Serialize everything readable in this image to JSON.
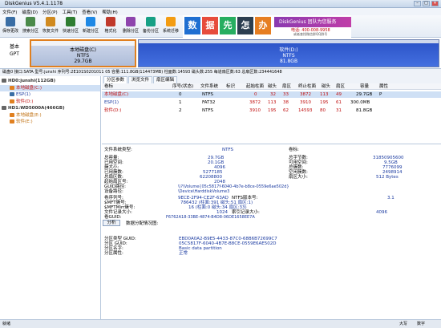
{
  "window": {
    "title": "DiskGenius V5.4.1.1178",
    "min": "–",
    "max": "□",
    "close": "✕"
  },
  "menu": [
    "文件(F)",
    "磁盘(D)",
    "分区(P)",
    "工具(T)",
    "查看(V)",
    "帮助(H)"
  ],
  "toolbar": [
    {
      "label": "保存更改",
      "icon": "save-icon",
      "color": "#3a6ea5"
    },
    {
      "label": "搜索分区",
      "icon": "search-icon",
      "color": "#4a8a4a"
    },
    {
      "label": "恢复文件",
      "icon": "recover-icon",
      "color": "#d08a20"
    },
    {
      "label": "快速分区",
      "icon": "quick-partition-icon",
      "color": "#2e7d32"
    },
    {
      "label": "新建分区",
      "icon": "new-partition-icon",
      "color": "#1e88e5"
    },
    {
      "label": "格式化",
      "icon": "format-icon",
      "color": "#c0392b"
    },
    {
      "label": "删除分区",
      "icon": "delete-icon",
      "color": "#8e44ad"
    },
    {
      "label": "备份分区",
      "icon": "backup-icon",
      "color": "#16a085"
    },
    {
      "label": "系统迁移",
      "icon": "migrate-icon",
      "color": "#f39c12"
    }
  ],
  "banner": {
    "chars": [
      "数",
      "据",
      "先",
      "怎",
      "办"
    ],
    "colors": [
      "#1f6fd1",
      "#e74c3c",
      "#27ae60",
      "#2c3e50",
      "#e67e22"
    ],
    "brand": "DiskGenius 团队为您服务",
    "phone": "电话: 400-008-9958",
    "sub": "或者查找微信群QQ群号"
  },
  "disk": {
    "label1": "基本",
    "label2": "GPT",
    "partC": {
      "name": "本地磁盘(C)",
      "fs": "NTFS",
      "size": "29.7GB"
    },
    "partD": {
      "name": "软件(D:)",
      "fs": "NTFS",
      "size": "81.8GB"
    }
  },
  "infobar": "磁盘0 接口:SATA 型号:junshi 序列号:2E101S0201011 05 容量:111.8GB(114473MB) 柱面数:14593 磁头数:255 每道扇区数:63 总扇区数:234441648",
  "tree": [
    {
      "label": "HD0:junshi(112GB)",
      "indent": 2,
      "color": "#333",
      "icon": "disk-icon"
    },
    {
      "label": "本地磁盘(C:)",
      "indent": 12,
      "color": "#c01010",
      "icon": "partition-icon",
      "selected": true
    },
    {
      "label": "ESP(1)",
      "indent": 12,
      "color": "#1a3aa0",
      "icon": "partition-icon"
    },
    {
      "label": "软件(D:)",
      "indent": 12,
      "color": "#c01010",
      "icon": "partition-icon"
    },
    {
      "label": "HD1:WD5000A(466GB)",
      "indent": 2,
      "color": "#333",
      "icon": "disk-icon"
    },
    {
      "label": "本地磁盘(E:)",
      "indent": 12,
      "color": "#c07010",
      "icon": "partition-icon"
    },
    {
      "label": "软件(E:)",
      "indent": 12,
      "color": "#c07010",
      "icon": "partition-icon"
    }
  ],
  "tabs": [
    "分区参数",
    "浏览文件",
    "扇区编辑"
  ],
  "table": {
    "headers": [
      "卷标",
      "序号(状态)",
      "文件系统",
      "标识",
      "起始柱面",
      "磁头",
      "扇区",
      "终止柱面",
      "磁头",
      "扇区",
      "容量",
      "属性"
    ],
    "rows": [
      [
        "本地磁盘(C)",
        "0",
        "NTFS",
        "",
        "0",
        "32",
        "33",
        "3872",
        "113",
        "49",
        "29.7GB",
        "P"
      ],
      [
        "ESP(1)",
        "1",
        "FAT32",
        "",
        "3872",
        "113",
        "38",
        "3910",
        "195",
        "61",
        "300.0MB",
        ""
      ],
      [
        "软件(D:)",
        "2",
        "NTFS",
        "",
        "3910",
        "195",
        "62",
        "14593",
        "80",
        "31",
        "81.8GB",
        ""
      ]
    ]
  },
  "details": {
    "fs_type_label": "文件系统类型:",
    "fs_type": "NTFS",
    "volume_label_label": "卷标:",
    "left_labels": [
      "总容量:",
      "已用空间:",
      "簇大小:",
      "已用簇数:",
      "总扇区数:",
      "起始扇区号:",
      "GUID路径:",
      "设备路径:"
    ],
    "left_values": [
      "29.7GB",
      "20.1GB",
      "4096",
      "5277185",
      "62208800",
      "2048",
      "\\\\?\\Volume{05c5817f-6040-4b7e-b8ce-0559e6ae502d}",
      "\\Device\\HarddiskVolume3"
    ],
    "right_labels": [
      "总字节数:",
      "可用空间:",
      "总簇数:",
      "空闲簇数:",
      "扇区大小:"
    ],
    "right_values": [
      "31850905600",
      "9.5GB",
      "7776099",
      "2498914",
      "512 Bytes"
    ],
    "serial_label": "卷序列号:",
    "serial": "9ECE-2F94-CE2F-63AD",
    "ntfs_ver_label": "NTFS版本号:",
    "ntfs_ver": "3.1",
    "mft_labels": [
      "$MFT簇号:",
      "$MFTMirr簇号:",
      "文件记录大小:",
      "卷GUID:"
    ],
    "mft_values": [
      "786432 (柱面:391 磁头:51 扇区:1)",
      "16 (柱面:0 磁头:34 扇区:33)",
      "1024",
      "F6762A18-33BE-4874-B4D8-06DE1658EE7A"
    ],
    "index_label": "索引记录大小:",
    "index_value": "4096",
    "analyze_button": "分析",
    "analyze_hint": "数据分配情况图:",
    "ptype_labels": [
      "分区类型 GUID:",
      "分区 GUID:",
      "分区名字:",
      "分区属性:"
    ],
    "ptype_values": [
      "EBD0A0A2-B9E5-4433-87C0-68B6B72699C7",
      "05C5817F-6040-4B7E-B8CE-0559E6AE502D",
      "Basic data partition",
      "正常"
    ]
  },
  "status": {
    "left": "就绪",
    "caps": "大写",
    "num": "数字"
  }
}
